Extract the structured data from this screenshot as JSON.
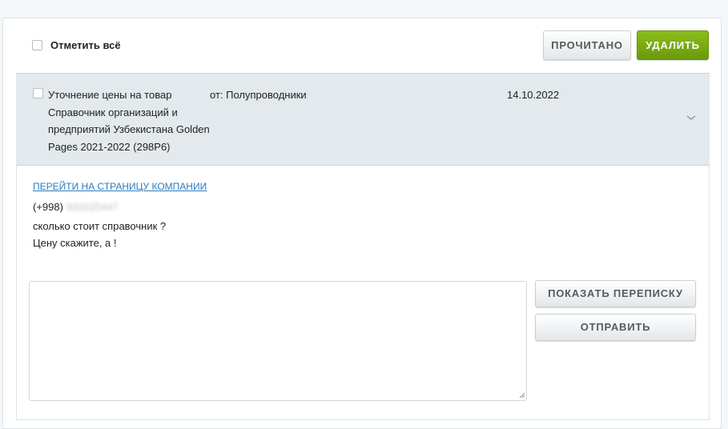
{
  "toolbar": {
    "select_all_label": "Отметить всё",
    "read_button": "ПРОЧИТАНО",
    "delete_button": "УДАЛИТЬ"
  },
  "message": {
    "subject_lines": [
      "Уточнение цены на товар",
      "Справочник организаций и",
      "предприятий Узбекистана Golden",
      "Pages 2021-2022 (298P6)"
    ],
    "from": "от: Полупроводники",
    "date": "14.10.2022",
    "company_link": "ПЕРЕЙТИ НА СТРАНИЦУ КОМПАНИИ",
    "phone_code": "(+998)",
    "phone_number": "932025447",
    "text_lines": [
      "сколько стоит справочник ?",
      "Цену скажите, а !"
    ]
  },
  "reply": {
    "textarea_value": "",
    "show_thread_button": "ПОКАЗАТЬ ПЕРЕПИСКУ",
    "send_button": "ОТПРАВИТЬ"
  },
  "colors": {
    "accent_green": "#7aac12",
    "link_blue": "#2a7bc0",
    "header_bg": "#e3e9ec"
  }
}
